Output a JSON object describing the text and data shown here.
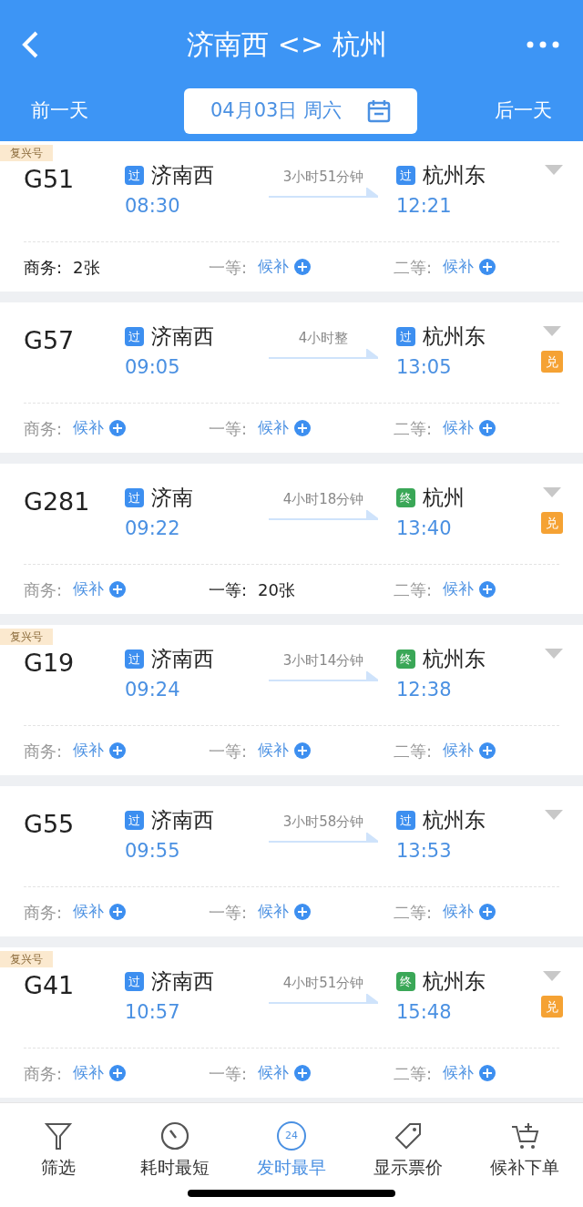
{
  "header": {
    "title": "济南西 <> 杭州",
    "prev_day": "前一天",
    "date": "04月03日 周六",
    "next_day": "后一天"
  },
  "trains": [
    {
      "tag": "复兴号",
      "number": "G51",
      "from": {
        "badge": "过",
        "kind": "pass",
        "station": "济南西",
        "time": "08:30"
      },
      "duration": "3小时51分钟",
      "to": {
        "badge": "过",
        "kind": "pass",
        "station": "杭州东",
        "time": "12:21"
      },
      "seats": [
        {
          "label": "商务:",
          "kind": "count",
          "value": "2张"
        },
        {
          "label": "一等:",
          "kind": "waitlist",
          "value": "候补"
        },
        {
          "label": "二等:",
          "kind": "waitlist",
          "value": "候补"
        }
      ]
    },
    {
      "number": "G57",
      "from": {
        "badge": "过",
        "kind": "pass",
        "station": "济南西",
        "time": "09:05"
      },
      "duration": "4小时整",
      "to": {
        "badge": "过",
        "kind": "pass",
        "station": "杭州东",
        "time": "13:05"
      },
      "exchange": "兑",
      "seats": [
        {
          "label": "商务:",
          "kind": "waitlist",
          "value": "候补"
        },
        {
          "label": "一等:",
          "kind": "waitlist",
          "value": "候补"
        },
        {
          "label": "二等:",
          "kind": "waitlist",
          "value": "候补"
        }
      ]
    },
    {
      "number": "G281",
      "from": {
        "badge": "过",
        "kind": "pass",
        "station": "济南",
        "time": "09:22"
      },
      "duration": "4小时18分钟",
      "to": {
        "badge": "终",
        "kind": "end",
        "station": "杭州",
        "time": "13:40"
      },
      "exchange": "兑",
      "seats": [
        {
          "label": "商务:",
          "kind": "waitlist",
          "value": "候补"
        },
        {
          "label": "一等:",
          "kind": "count",
          "value": "20张"
        },
        {
          "label": "二等:",
          "kind": "waitlist",
          "value": "候补"
        }
      ]
    },
    {
      "tag": "复兴号",
      "number": "G19",
      "from": {
        "badge": "过",
        "kind": "pass",
        "station": "济南西",
        "time": "09:24"
      },
      "duration": "3小时14分钟",
      "to": {
        "badge": "终",
        "kind": "end",
        "station": "杭州东",
        "time": "12:38"
      },
      "seats": [
        {
          "label": "商务:",
          "kind": "waitlist",
          "value": "候补"
        },
        {
          "label": "一等:",
          "kind": "waitlist",
          "value": "候补"
        },
        {
          "label": "二等:",
          "kind": "waitlist",
          "value": "候补"
        }
      ]
    },
    {
      "number": "G55",
      "from": {
        "badge": "过",
        "kind": "pass",
        "station": "济南西",
        "time": "09:55"
      },
      "duration": "3小时58分钟",
      "to": {
        "badge": "过",
        "kind": "pass",
        "station": "杭州东",
        "time": "13:53"
      },
      "seats": [
        {
          "label": "商务:",
          "kind": "waitlist",
          "value": "候补"
        },
        {
          "label": "一等:",
          "kind": "waitlist",
          "value": "候补"
        },
        {
          "label": "二等:",
          "kind": "waitlist",
          "value": "候补"
        }
      ]
    },
    {
      "tag": "复兴号",
      "number": "G41",
      "from": {
        "badge": "过",
        "kind": "pass",
        "station": "济南西",
        "time": "10:57"
      },
      "duration": "4小时51分钟",
      "to": {
        "badge": "终",
        "kind": "end",
        "station": "杭州东",
        "time": "15:48"
      },
      "exchange": "兑",
      "seats": [
        {
          "label": "商务:",
          "kind": "waitlist",
          "value": "候补"
        },
        {
          "label": "一等:",
          "kind": "waitlist",
          "value": "候补"
        },
        {
          "label": "二等:",
          "kind": "waitlist",
          "value": "候补"
        }
      ]
    }
  ],
  "toolbar": [
    {
      "label": "筛选",
      "kind": "filter",
      "selected": false
    },
    {
      "label": "耗时最短",
      "kind": "timer",
      "selected": false
    },
    {
      "label": "发时最早",
      "kind": "clock",
      "icon_text": "24",
      "selected": true
    },
    {
      "label": "显示票价",
      "kind": "tag",
      "selected": false
    },
    {
      "label": "候补下单",
      "kind": "cart",
      "selected": false
    }
  ]
}
